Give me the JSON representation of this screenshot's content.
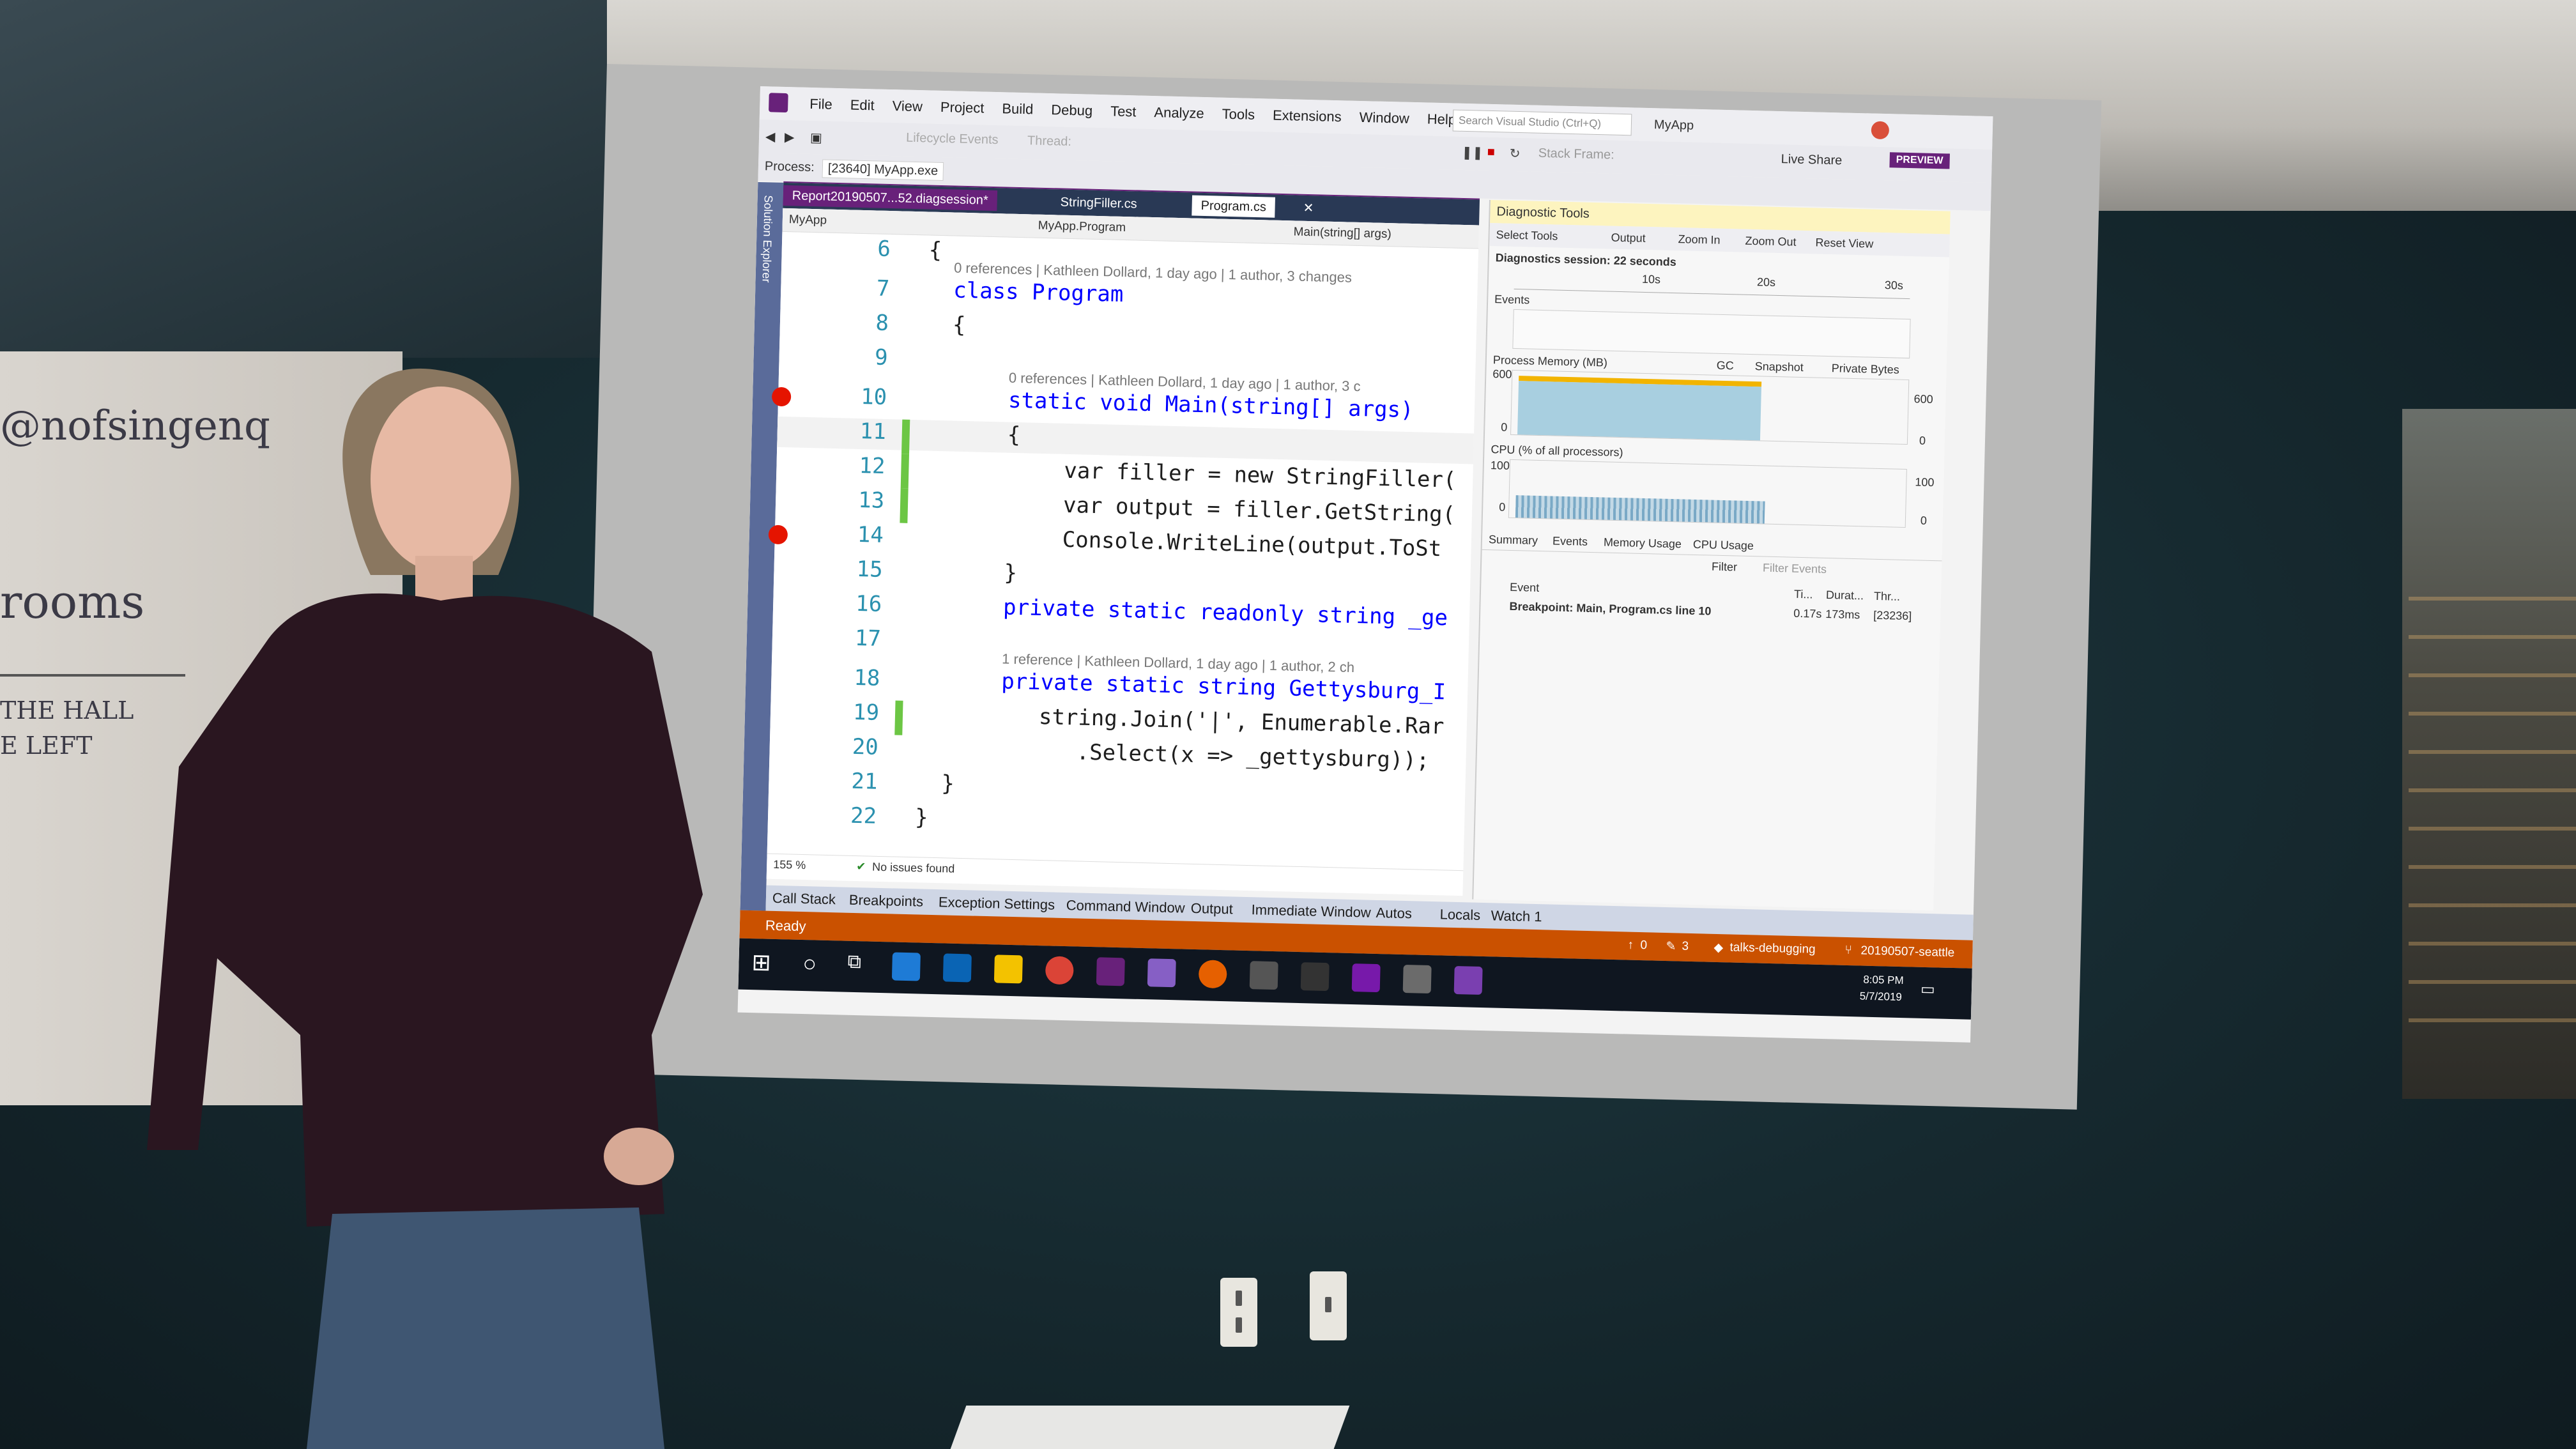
{
  "ide": {
    "app_name": "MyApp",
    "menu": [
      "File",
      "Edit",
      "View",
      "Project",
      "Build",
      "Debug",
      "Test",
      "Analyze",
      "Tools",
      "Extensions",
      "Window",
      "Help"
    ],
    "search_placeholder": "Search Visual Studio (Ctrl+Q)",
    "process_label": "Process:",
    "process_value": "[23640] MyApp.exe",
    "lifecycle_events": "Lifecycle Events",
    "thread_label": "Thread:",
    "stack_frame_label": "Stack Frame:",
    "live_share": "Live Share",
    "preview_badge": "PREVIEW",
    "diag_session_file": "Report20190507...52.diagsession*",
    "sidebar_label": "Solution Explorer",
    "tabs": [
      "StringFiller.cs",
      "Program.cs"
    ],
    "nav": {
      "project": "MyApp",
      "class": "MyApp.Program",
      "member": "Main(string[] args)"
    },
    "code": {
      "lines": [
        {
          "n": "6",
          "text": "{"
        },
        {
          "n": "7",
          "text": "class Program"
        },
        {
          "n": "8",
          "text": "{"
        },
        {
          "n": "9",
          "text": ""
        },
        {
          "n": "10",
          "text": "static void Main(string[] args)"
        },
        {
          "n": "11",
          "text": "{"
        },
        {
          "n": "12",
          "text": "var filler = new StringFiller("
        },
        {
          "n": "13",
          "text": "var output = filler.GetString("
        },
        {
          "n": "14",
          "text": "Console.WriteLine(output.ToSt"
        },
        {
          "n": "15",
          "text": "}"
        },
        {
          "n": "16",
          "text": "private static readonly string _ge"
        },
        {
          "n": "17",
          "text": ""
        },
        {
          "n": "18",
          "text": "private static string Gettysburg_I"
        },
        {
          "n": "19",
          "text": "string.Join('|', Enumerable.Rar"
        },
        {
          "n": "20",
          "text": ".Select(x => _gettysburg));"
        },
        {
          "n": "21",
          "text": "}"
        },
        {
          "n": "22",
          "text": "}"
        }
      ],
      "lens_class": "0 references | Kathleen Dollard, 1 day ago | 1 author, 3 changes",
      "lens_main": "0 references | Kathleen Dollard, 1 day ago | 1 author, 3 c",
      "lens_gettysburg": "1 reference | Kathleen Dollard, 1 day ago | 1 author, 2 ch"
    },
    "zoom": "155 %",
    "issues": "No issues found",
    "diagnostics": {
      "title": "Diagnostic Tools",
      "select_tools": "Select Tools",
      "output": "Output",
      "zoom_in": "Zoom In",
      "zoom_out": "Zoom Out",
      "reset_view": "Reset View",
      "session": "Diagnostics session: 22 seconds",
      "ticks": [
        "10s",
        "20s",
        "30s"
      ],
      "events_label": "Events",
      "memory_label": "Process Memory (MB)",
      "memory_legend": [
        "GC",
        "Snapshot",
        "Private Bytes"
      ],
      "memory_axis": [
        "600",
        "0"
      ],
      "memory_axis_right": [
        "600",
        "0"
      ],
      "cpu_label": "CPU (% of all processors)",
      "cpu_axis": [
        "100",
        "0"
      ],
      "cpu_axis_right": [
        "100",
        "0"
      ],
      "tabs": [
        "Summary",
        "Events",
        "Memory Usage",
        "CPU Usage"
      ],
      "filter": "Filter",
      "filter_placeholder": "Filter Events",
      "columns": [
        "Event",
        "Ti...",
        "Durat...",
        "Thr..."
      ],
      "row": {
        "event": "Breakpoint: Main, Program.cs line 10",
        "time": "0.17s",
        "duration": "173ms",
        "thread": "[23236]"
      }
    },
    "bottom_tabs": [
      "Call Stack",
      "Breakpoints",
      "Exception Settings",
      "Command Window",
      "Output",
      "Immediate Window",
      "Autos",
      "Locals",
      "Watch 1"
    ],
    "status": {
      "text": "Ready",
      "errors": "0",
      "edits": "3",
      "branch": "talks-debugging",
      "repo": "20190507-seattle"
    },
    "taskbar": {
      "time": "8:05 PM",
      "date": "5/7/2019"
    },
    "colors": {
      "accent": "#68217a",
      "status_bar": "#ca5100",
      "breakpoint": "#e51400",
      "changed": "#6cc644"
    }
  },
  "whiteboard": {
    "lines": [
      "@nofsingenq",
      "rooms",
      "THE HALL",
      "E LEFT"
    ]
  }
}
